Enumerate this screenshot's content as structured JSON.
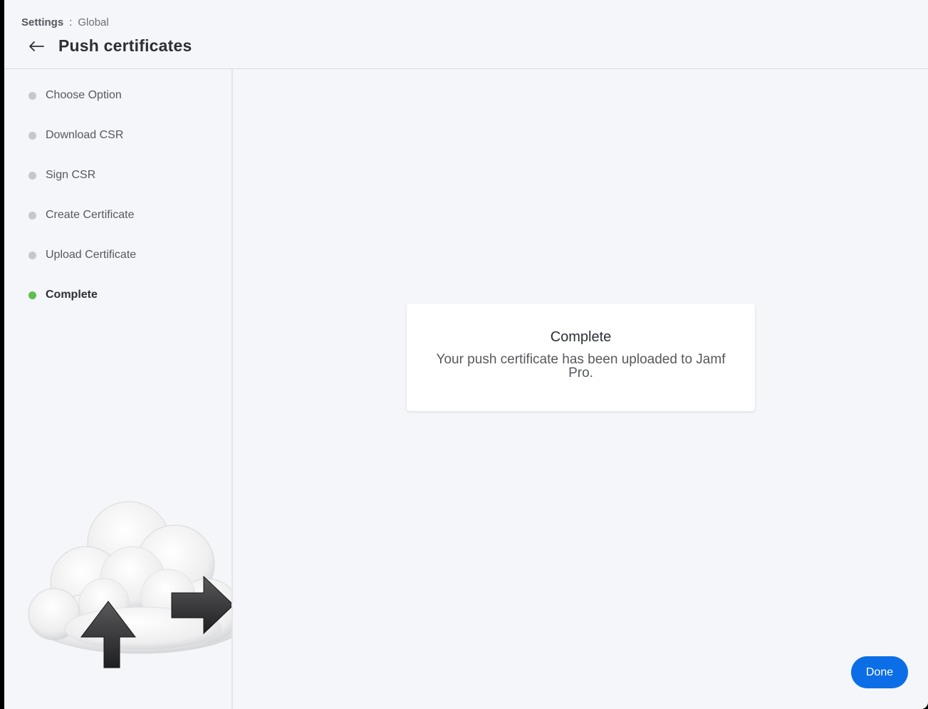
{
  "breadcrumb": {
    "parent": "Settings",
    "separator": ":",
    "current": "Global"
  },
  "page": {
    "title": "Push certificates",
    "back_icon": "arrow-left-icon"
  },
  "steps": [
    {
      "label": "Choose Option",
      "status": "inactive"
    },
    {
      "label": "Download CSR",
      "status": "inactive"
    },
    {
      "label": "Sign CSR",
      "status": "inactive"
    },
    {
      "label": "Create Certificate",
      "status": "inactive"
    },
    {
      "label": "Upload Certificate",
      "status": "inactive"
    },
    {
      "label": "Complete",
      "status": "active"
    }
  ],
  "card": {
    "title": "Complete",
    "message": "Your push certificate has been uploaded to Jamf Pro."
  },
  "actions": {
    "done_label": "Done"
  },
  "colors": {
    "accent": "#0b6ee6",
    "step_active": "#5cc04a",
    "step_inactive": "#c6c7cb",
    "background": "#f5f6fa"
  },
  "illustration": {
    "icon": "cloud-upload-illustration"
  }
}
